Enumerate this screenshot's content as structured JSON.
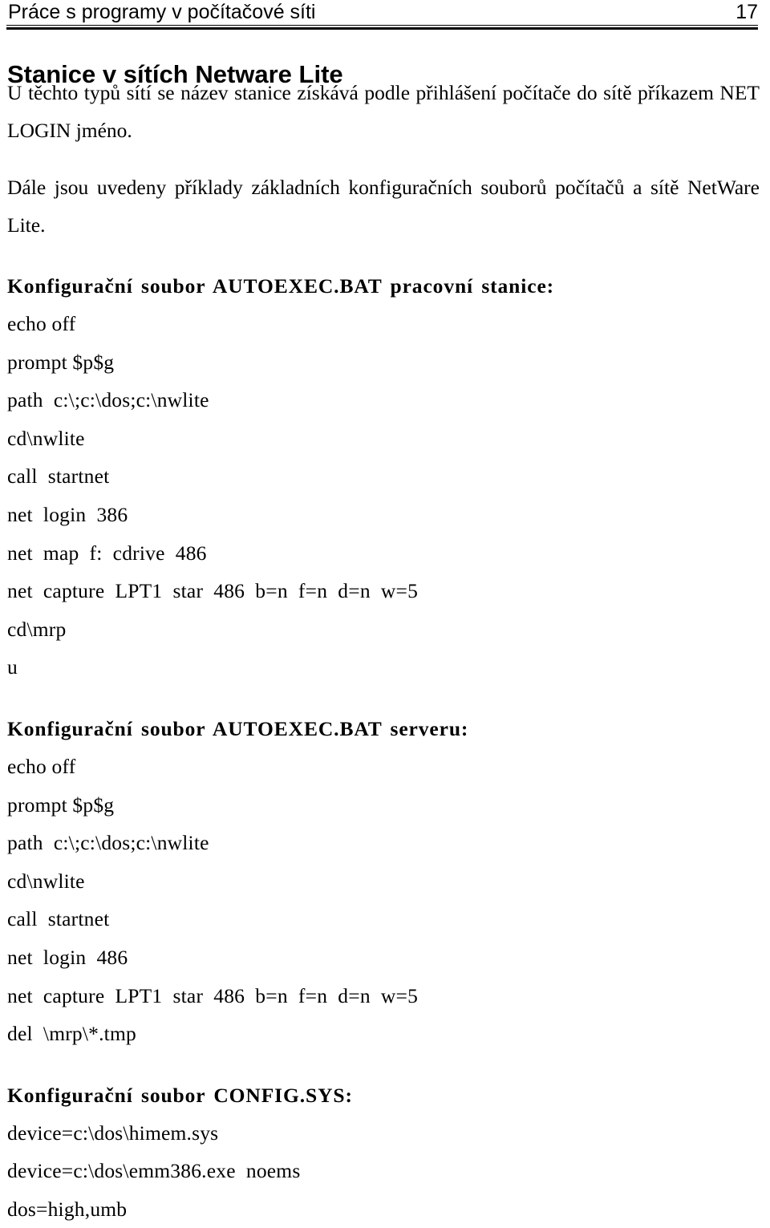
{
  "header": {
    "running_title": "Práce s programy v počítačové síti",
    "page_number": "17"
  },
  "section": {
    "title": "Stanice v sítích Netware Lite"
  },
  "paragraphs": [
    "U těchto typů sítí se název stanice získává podle přihlášení počítače do sítě příkazem NET LOGIN jméno.",
    "Dále jsou uvedeny příklady základních konfiguračních souborů počítačů a sítě NetWare Lite."
  ],
  "blocks": [
    {
      "heading": "Konfigurační soubor AUTOEXEC.BAT pracovní stanice:",
      "lines": [
        "echo off",
        "prompt $p$g",
        "path  c:\\;c:\\dos;c:\\nwlite",
        "cd\\nwlite",
        "call  startnet",
        "net  login  386",
        "net  map  f:  cdrive  486",
        "net  capture  LPT1  star  486  b=n  f=n  d=n  w=5",
        "cd\\mrp",
        "u"
      ]
    },
    {
      "heading": "Konfigurační soubor AUTOEXEC.BAT serveru:",
      "lines": [
        "echo off",
        "prompt $p$g",
        "path  c:\\;c:\\dos;c:\\nwlite",
        "cd\\nwlite",
        "call  startnet",
        "net  login  486",
        "net  capture  LPT1  star  486  b=n  f=n  d=n  w=5",
        "del  \\mrp\\*.tmp"
      ]
    },
    {
      "heading": "Konfigurační soubor CONFIG.SYS:",
      "lines": [
        "device=c:\\dos\\himem.sys",
        "device=c:\\dos\\emm386.exe  noems",
        "dos=high,umb"
      ]
    }
  ]
}
